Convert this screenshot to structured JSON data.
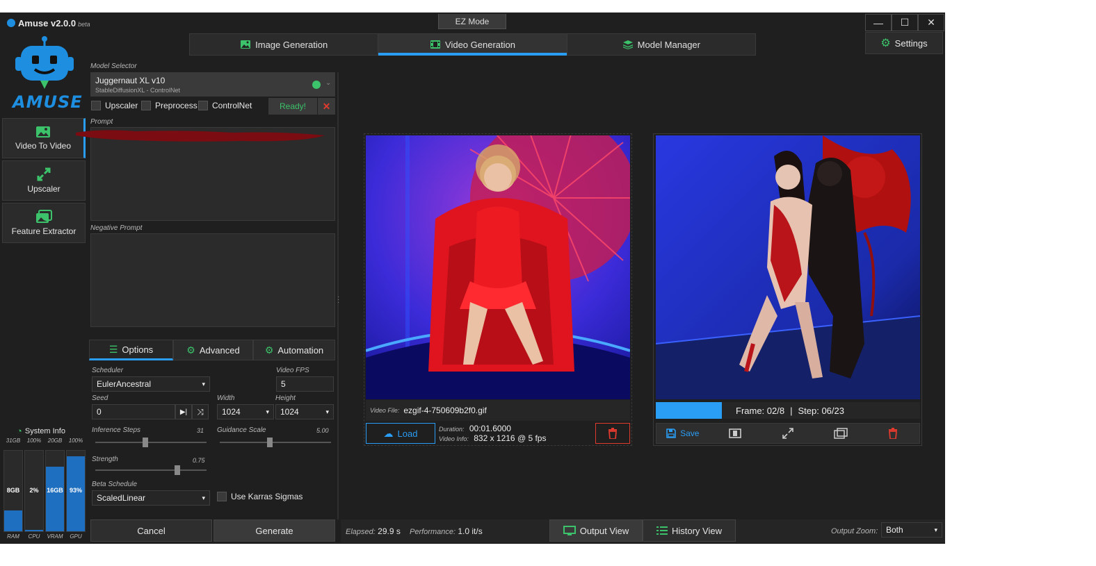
{
  "app": {
    "title": "Amuse v2.0.0",
    "beta": "beta",
    "ez_mode": "EZ Mode",
    "logo_text": "AMUSE"
  },
  "window_controls": {
    "minimize": "—",
    "maximize": "☐",
    "close": "✕"
  },
  "tabs": [
    {
      "label": "Image Generation",
      "icon": "image-icon"
    },
    {
      "label": "Video Generation",
      "icon": "film-icon",
      "active": true
    },
    {
      "label": "Model Manager",
      "icon": "layers-icon"
    }
  ],
  "settings": {
    "label": "Settings"
  },
  "left_nav": [
    {
      "label": "Video To Video",
      "active": true
    },
    {
      "label": "Upscaler"
    },
    {
      "label": "Feature Extractor"
    }
  ],
  "model_selector": {
    "label": "Model Selector",
    "name": "Juggernaut XL v10",
    "sub": "StableDiffusionXL - ControlNet",
    "status_color": "#3cc26a"
  },
  "toggles": {
    "upscaler": "Upscaler",
    "preprocess": "Preprocess",
    "controlnet": "ControlNet",
    "ready": "Ready!"
  },
  "prompt": {
    "label": "Prompt",
    "value": ""
  },
  "negative_prompt": {
    "label": "Negative Prompt",
    "value": ""
  },
  "subtabs": [
    {
      "label": "Options",
      "active": true
    },
    {
      "label": "Advanced"
    },
    {
      "label": "Automation"
    }
  ],
  "options": {
    "scheduler_label": "Scheduler",
    "scheduler": "EulerAncestral",
    "fps_label": "Video FPS",
    "fps": "5",
    "seed_label": "Seed",
    "seed": "0",
    "width_label": "Width",
    "width": "1024",
    "height_label": "Height",
    "height": "1024",
    "steps_label": "Inference Steps",
    "steps": "31",
    "steps_pct": 0.45,
    "guidance_label": "Guidance Scale",
    "guidance": "5.00",
    "guidance_pct": 0.45,
    "strength_label": "Strength",
    "strength": "0.75",
    "strength_pct": 0.75,
    "beta_label": "Beta Schedule",
    "beta": "ScaledLinear",
    "karras_label": "Use Karras Sigmas"
  },
  "system_info": {
    "label": "System Info",
    "bars": [
      {
        "name": "RAM",
        "top": "31GB",
        "value": "8GB",
        "pct": 0.26
      },
      {
        "name": "CPU",
        "top": "100%",
        "value": "2%",
        "pct": 0.02
      },
      {
        "name": "VRAM",
        "top": "20GB",
        "value": "16GB",
        "pct": 0.8
      },
      {
        "name": "GPU",
        "top": "100%",
        "value": "93%",
        "pct": 0.93
      }
    ]
  },
  "actions": {
    "cancel": "Cancel",
    "generate": "Generate"
  },
  "input_video": {
    "file_label": "Video File:",
    "file": "ezgif-4-750609b2f0.gif",
    "load": "Load",
    "duration_label": "Duration:",
    "duration": "00:01.6000",
    "info_label": "Video Info:",
    "info": "832 x 1216 @ 5 fps"
  },
  "output_video": {
    "frame": "Frame: 02/8",
    "sep": "|",
    "step": "Step: 06/23",
    "progress_pct": 0.25,
    "save": "Save"
  },
  "status": {
    "elapsed_label": "Elapsed:",
    "elapsed": "29.9 s",
    "perf_label": "Performance:",
    "perf": "1.0 it/s",
    "output_view": "Output View",
    "history_view": "History View",
    "zoom_label": "Output Zoom:",
    "zoom": "Both"
  },
  "colors": {
    "accent": "#2a9df4",
    "brand": "#1e8fe0",
    "green": "#3cc26a",
    "danger": "#e03a2f"
  }
}
